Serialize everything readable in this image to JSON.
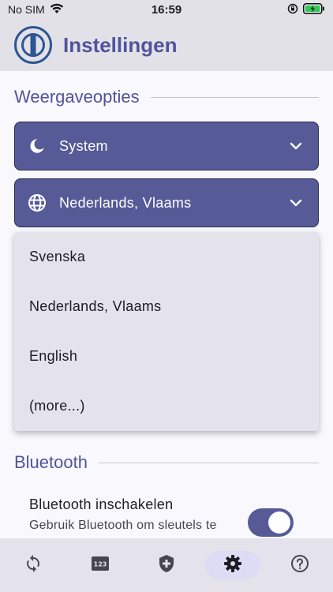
{
  "status_bar": {
    "carrier": "No SIM",
    "time": "16:59"
  },
  "header": {
    "title": "Instellingen"
  },
  "sections": {
    "display": {
      "title": "Weergaveopties",
      "theme_dropdown": {
        "value": "System",
        "icon": "moon-icon"
      },
      "language_dropdown": {
        "value": "Nederlands, Vlaams",
        "icon": "globe-icon"
      }
    },
    "bluetooth": {
      "title": "Bluetooth",
      "enable_title": "Bluetooth inschakelen",
      "enable_subtitle": "Gebruik Bluetooth om sleutels te",
      "toggle_on": true
    }
  },
  "language_menu": {
    "items": [
      {
        "label": "Svenska"
      },
      {
        "label": "Nederlands, Vlaams"
      },
      {
        "label": "English"
      },
      {
        "label": "(more...)"
      }
    ]
  },
  "bottom_nav": {
    "items": [
      {
        "icon": "refresh-icon",
        "active": false
      },
      {
        "icon": "numeric-icon",
        "active": false
      },
      {
        "icon": "shield-plus-icon",
        "active": false
      },
      {
        "icon": "gear-icon",
        "active": true
      },
      {
        "icon": "help-icon",
        "active": false
      }
    ]
  },
  "colors": {
    "accent": "#565a97",
    "title": "#51539a",
    "surface": "#e2e1e8",
    "background": "#f8f8fd"
  }
}
